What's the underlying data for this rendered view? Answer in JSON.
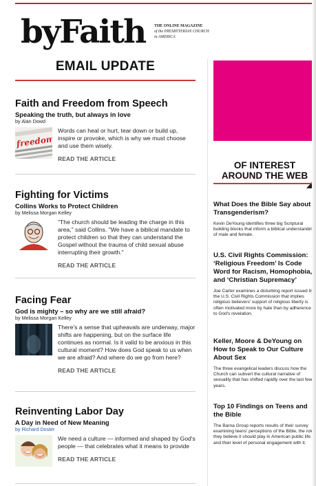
{
  "masthead": {
    "logo": "byFaith",
    "tagline_line1": "THE ONLINE MAGAZINE",
    "tagline_line2": "of the PRESBYTERIAN CHURCH",
    "tagline_line3": "in AMERICA"
  },
  "section_title": "EMAIL UPDATE",
  "read_more_label": "READ THE ARTICLE",
  "articles": [
    {
      "title": "Faith and Freedom from Speech",
      "subtitle": "Speaking the truth, but always in love",
      "byline": "by Alan Dowd",
      "blurb": "Words can heal or hurt, tear down or build up, inspire or provoke, which is why we must choose and use them wisely.",
      "thumb_text": "freedom"
    },
    {
      "title": "Fighting for Victims",
      "subtitle": "Collins Works to Protect Children",
      "byline": "by Melissa Morgan Kelley",
      "blurb": "\"The church should be leading the charge in this area,\" said Collins. \"We have a biblical mandate to protect children so that they can understand the Gospel without the trauma of child sexual abuse interrupting their growth.\""
    },
    {
      "title": "Facing Fear",
      "subtitle": "God is mighty – so why are we still afraid?",
      "byline": "by Melissa Morgan Kelley",
      "blurb": "There's a sense that upheavals are underway, major shifts are happening, but on the surface life continues as normal. Is it valid to be anxious in this cultural moment? How does God speak to us when we are afraid? And where do we go from here?"
    },
    {
      "title": "Reinventing Labor Day",
      "subtitle": "A Day in Need of New Meaning",
      "byline": "by Richard Doster",
      "blurb": "We need a culture — informed and shaped by God's people — that celebrates what it means to provide"
    }
  ],
  "sidebar": {
    "title": "OF INTEREST AROUND THE WEB",
    "items": [
      {
        "title": "What Does the Bible Say about Transgenderism?",
        "body": "Kevin DeYoung identifies three big Scriptural building blocks that inform a biblical understanding of male and female."
      },
      {
        "title": "U.S. Civil Rights Commission: ‘Religious Freedom’ Is Code Word for Racism, Homophobia, and ‘Christian Supremacy’",
        "body": "Joe Carter examines a disturbing report issued by the U.S. Civil Rights Commission that implies religious believers' support of religious liberty is often motivated more by hate than by adherence to God's revelation."
      },
      {
        "title": "Keller, Moore & DeYoung on How to Speak to Our Culture About Sex",
        "body": "The three evangelical leaders discuss how the Church can subvert the cultural narrative of sexuality that has shifted rapidly over the last few years."
      },
      {
        "title": "Top 10 Findings on Teens and the Bible",
        "body": "The Barna Group reports results of their survey examining teens' perceptions of the Bible, the role they believe it should play in American public life and their level of personal engagement with it."
      }
    ]
  },
  "colors": {
    "accent_red": "#c43a3a",
    "promo_magenta": "#e5007e",
    "link_blue": "#2a5db0"
  }
}
